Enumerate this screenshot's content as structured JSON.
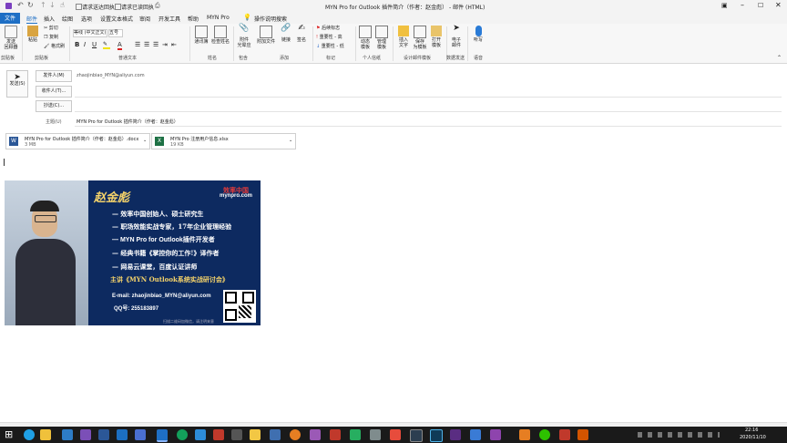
{
  "titlebar": {
    "checkbox_read_receipt": "请求送达回执",
    "checkbox_read_receipt2": "请求已读回执",
    "title": "MYN Pro for Outlook 插件简介（作者：赵金彪） - 邮件 (HTML)"
  },
  "tabs": [
    "文件",
    "邮件",
    "插入",
    "绘图",
    "选项",
    "设置文本格式",
    "审阅",
    "开发工具",
    "帮助",
    "MYN Pro"
  ],
  "tell_me": "操作说明搜索",
  "ribbon": {
    "send_later": "发送\n回顾器",
    "paste": "粘贴",
    "cut": "剪切",
    "copy": "复制",
    "format_painter": "格式刷",
    "font_name": "等线 (中文正文)",
    "font_size": "五号",
    "address_book": "通讯簿",
    "check_names": "检查姓名",
    "attach_file": "附件\n光晕应",
    "attach_item": "附加文件",
    "link": "链接",
    "signature": "签名",
    "follow_up": "后续标志",
    "importance_high": "重要性 - 高",
    "importance_low": "重要性 - 低",
    "templates": "动态\n模板",
    "manage": "管理\n模板",
    "insert_text": "插入\n文字",
    "save_template": "保存\n为模板",
    "open_template": "打开\n模板",
    "email_send": "电子\n邮件",
    "dictate": "听写",
    "groups": [
      "剪贴板",
      "剪贴板",
      "普通文本",
      "姓名",
      "包含",
      "添加",
      "标记",
      "个人信纸",
      "设计邮件模板",
      "数据发送",
      "语音"
    ]
  },
  "compose": {
    "send_button": "发送(S)",
    "from_button": "发件人(M)",
    "from_value": "zhaojinbiao_MYN@aliyun.com",
    "to_button": "收件人(T)...",
    "cc_button": "抄送(C)...",
    "subject_label": "主题(U)",
    "subject_value": "MYN Pro for Outlook 插件简介（作者：赵金彪）"
  },
  "attachments": [
    {
      "name": "MYN Pro for Outlook 插件简介（作者：赵金彪）.docx",
      "size": "3 MB",
      "color": "#2b5797",
      "letter": "W"
    },
    {
      "name": "MYN Pro 注册用户信息.xlsx",
      "size": "19 KB",
      "color": "#1e7145",
      "letter": "X"
    }
  ],
  "signature": {
    "name": "赵金彪",
    "brand": "效率中国",
    "site": "mynpro.com",
    "lines": [
      "— 效率中国创始人、硕士研究生",
      "— 职场效能实战专家，17年企业管理经验",
      "— MYN Pro for Outlook插件开发者",
      "— 经典书籍《掌控你的工作!》译作者",
      "— 网易云课堂，百度认证讲师",
      "主讲《MYN Outlook系统实战研讨会》"
    ],
    "email": "E-mail: zhaojinbiao_MYN@aliyun.com",
    "qq": "QQ号: 255183897",
    "qr_caption": "扫描二维码加微信，请注明来意"
  },
  "clock": {
    "time": "22:16",
    "date": "2020/11/10"
  }
}
